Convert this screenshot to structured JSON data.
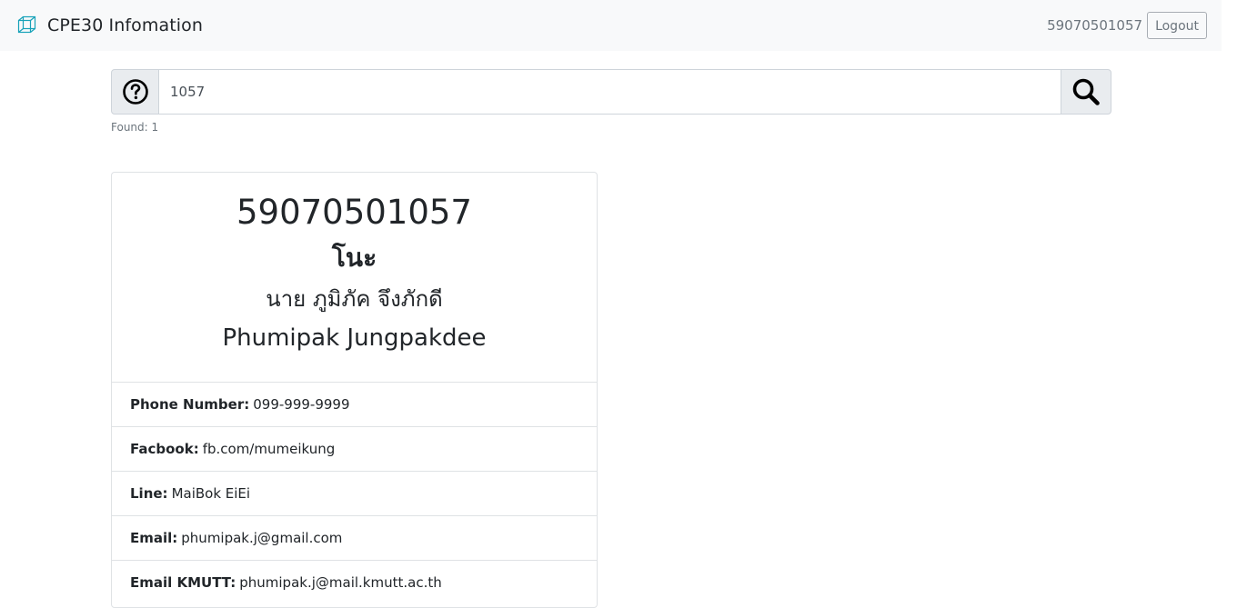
{
  "navbar": {
    "brand": "CPE30 Infomation",
    "user_id": "59070501057",
    "logout_label": "Logout"
  },
  "search": {
    "value": "1057",
    "found_text": "Found: 1"
  },
  "card": {
    "student_id": "59070501057",
    "nickname": "โนะ",
    "thai_name": "นาย ภูมิภัค จึงภักดี",
    "english_name": "Phumipak Jungpakdee",
    "details": [
      {
        "label": "Phone Number:",
        "value": "099-999-9999"
      },
      {
        "label": "Facbook:",
        "value": "fb.com/mumeikung"
      },
      {
        "label": "Line:",
        "value": "MaiBok EiEi"
      },
      {
        "label": "Email:",
        "value": "phumipak.j@gmail.com"
      },
      {
        "label": "Email KMUTT:",
        "value": "phumipak.j@mail.kmutt.ac.th"
      }
    ]
  },
  "colors": {
    "navbar_bg": "#f8f9fa",
    "logo": "#17a2b8",
    "border": "#ced4da",
    "muted_text": "#6c757d"
  },
  "icons": {
    "logo": "cube-icon",
    "help": "question-circle-icon",
    "search": "search-icon"
  }
}
